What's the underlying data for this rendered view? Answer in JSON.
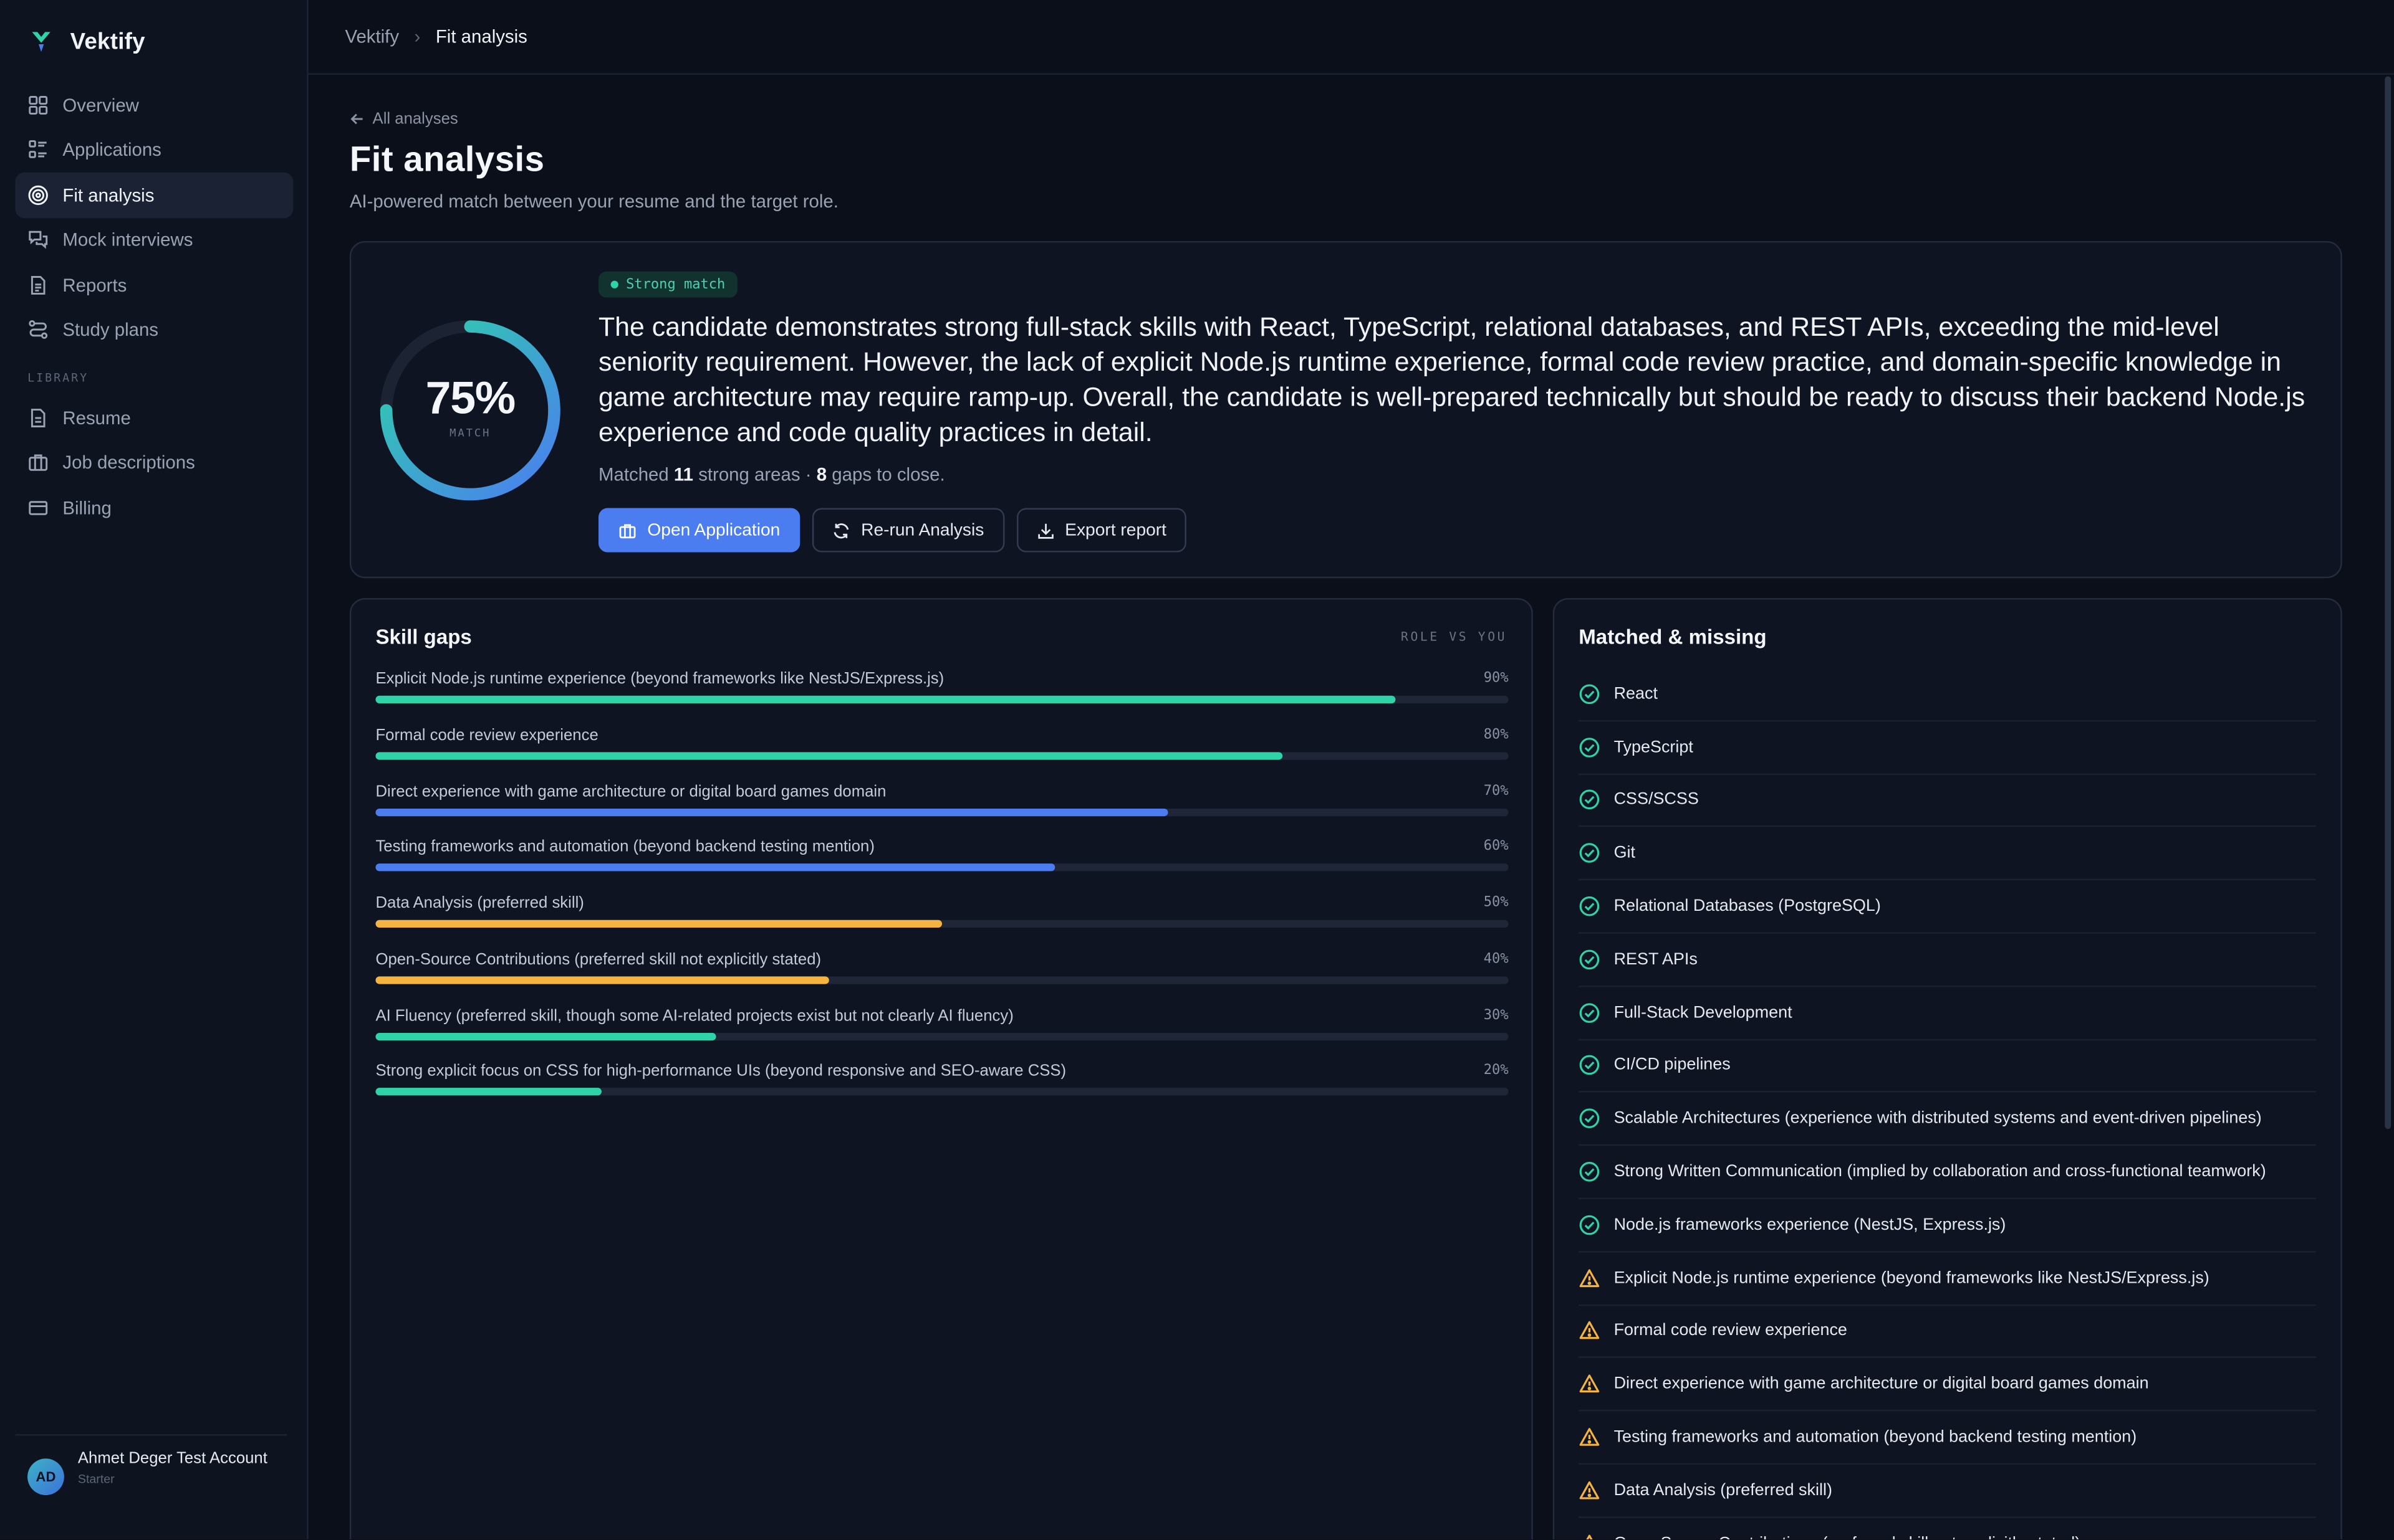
{
  "app": {
    "name": "Vektify"
  },
  "sidebar": {
    "items": [
      {
        "label": "Overview",
        "icon": "grid-icon"
      },
      {
        "label": "Applications",
        "icon": "list-icon"
      },
      {
        "label": "Fit analysis",
        "icon": "target-icon",
        "active": true
      },
      {
        "label": "Mock interviews",
        "icon": "chat-icon"
      },
      {
        "label": "Reports",
        "icon": "document-icon"
      },
      {
        "label": "Study plans",
        "icon": "route-icon"
      }
    ],
    "section_label": "LIBRARY",
    "library_items": [
      {
        "label": "Resume",
        "icon": "file-icon"
      },
      {
        "label": "Job descriptions",
        "icon": "briefcase-icon"
      },
      {
        "label": "Billing",
        "icon": "card-icon"
      }
    ],
    "user": {
      "initials": "AD",
      "name": "Ahmet Deger Test Account",
      "plan": "Starter"
    }
  },
  "breadcrumb": {
    "root": "Vektify",
    "separator": "›",
    "current": "Fit analysis"
  },
  "page": {
    "back_label": "All analyses",
    "title": "Fit analysis",
    "subtitle": "AI-powered match between your resume and the target role."
  },
  "summary": {
    "score": "75%",
    "score_value": 75,
    "score_label": "MATCH",
    "badge": "Strong match",
    "text": "The candidate demonstrates strong full-stack skills with React, TypeScript, relational databases, and REST APIs, exceeding the mid-level seniority requirement. However, the lack of explicit Node.js runtime experience, formal code review practice, and domain-specific knowledge in game architecture may require ramp-up. Overall, the candidate is well-prepared technically but should be ready to discuss their backend Node.js experience and code quality practices in detail.",
    "meta_prefix": "Matched",
    "matched_count": "11",
    "meta_middle": "strong areas ·",
    "gap_count": "8",
    "meta_suffix": "gaps to close.",
    "buttons": {
      "open": "Open Application",
      "rerun": "Re-run Analysis",
      "export": "Export report"
    }
  },
  "skill_gaps": {
    "title": "Skill gaps",
    "legend": "ROLE VS YOU",
    "items": [
      {
        "label": "Explicit Node.js runtime experience (beyond frameworks like NestJS/Express.js)",
        "pct": "90%",
        "value": 0.9,
        "color": "#2ed3a8"
      },
      {
        "label": "Formal code review experience",
        "pct": "80%",
        "value": 0.8,
        "color": "#2ed3a8"
      },
      {
        "label": "Direct experience with game architecture or digital board games domain",
        "pct": "70%",
        "value": 0.7,
        "color": "#4b7df0"
      },
      {
        "label": "Testing frameworks and automation (beyond backend testing mention)",
        "pct": "60%",
        "value": 0.6,
        "color": "#4b7df0"
      },
      {
        "label": "Data Analysis (preferred skill)",
        "pct": "50%",
        "value": 0.5,
        "color": "#f5b440"
      },
      {
        "label": "Open-Source Contributions (preferred skill not explicitly stated)",
        "pct": "40%",
        "value": 0.4,
        "color": "#f5b440"
      },
      {
        "label": "AI Fluency (preferred skill, though some AI-related projects exist but not clearly AI fluency)",
        "pct": "30%",
        "value": 0.3,
        "color": "#2ed3a8"
      },
      {
        "label": "Strong explicit focus on CSS for high-performance UIs (beyond responsive and SEO-aware CSS)",
        "pct": "20%",
        "value": 0.2,
        "color": "#2ed3a8"
      }
    ]
  },
  "matched_missing": {
    "title": "Matched & missing",
    "items": [
      {
        "label": "React",
        "status": "matched"
      },
      {
        "label": "TypeScript",
        "status": "matched"
      },
      {
        "label": "CSS/SCSS",
        "status": "matched"
      },
      {
        "label": "Git",
        "status": "matched"
      },
      {
        "label": "Relational Databases (PostgreSQL)",
        "status": "matched"
      },
      {
        "label": "REST APIs",
        "status": "matched"
      },
      {
        "label": "Full-Stack Development",
        "status": "matched"
      },
      {
        "label": "CI/CD pipelines",
        "status": "matched"
      },
      {
        "label": "Scalable Architectures (experience with distributed systems and event-driven pipelines)",
        "status": "matched"
      },
      {
        "label": "Strong Written Communication (implied by collaboration and cross-functional teamwork)",
        "status": "matched"
      },
      {
        "label": "Node.js frameworks experience (NestJS, Express.js)",
        "status": "matched"
      },
      {
        "label": "Explicit Node.js runtime experience (beyond frameworks like NestJS/Express.js)",
        "status": "missing"
      },
      {
        "label": "Formal code review experience",
        "status": "missing"
      },
      {
        "label": "Direct experience with game architecture or digital board games domain",
        "status": "missing"
      },
      {
        "label": "Testing frameworks and automation (beyond backend testing mention)",
        "status": "missing"
      },
      {
        "label": "Data Analysis (preferred skill)",
        "status": "missing"
      },
      {
        "label": "Open-Source Contributions (preferred skill not explicitly stated)",
        "status": "missing"
      }
    ]
  },
  "colors": {
    "accent": "#4b7df0",
    "matched": "#2ed3a8",
    "missing": "#f5b440",
    "background": "#0b0f19"
  }
}
